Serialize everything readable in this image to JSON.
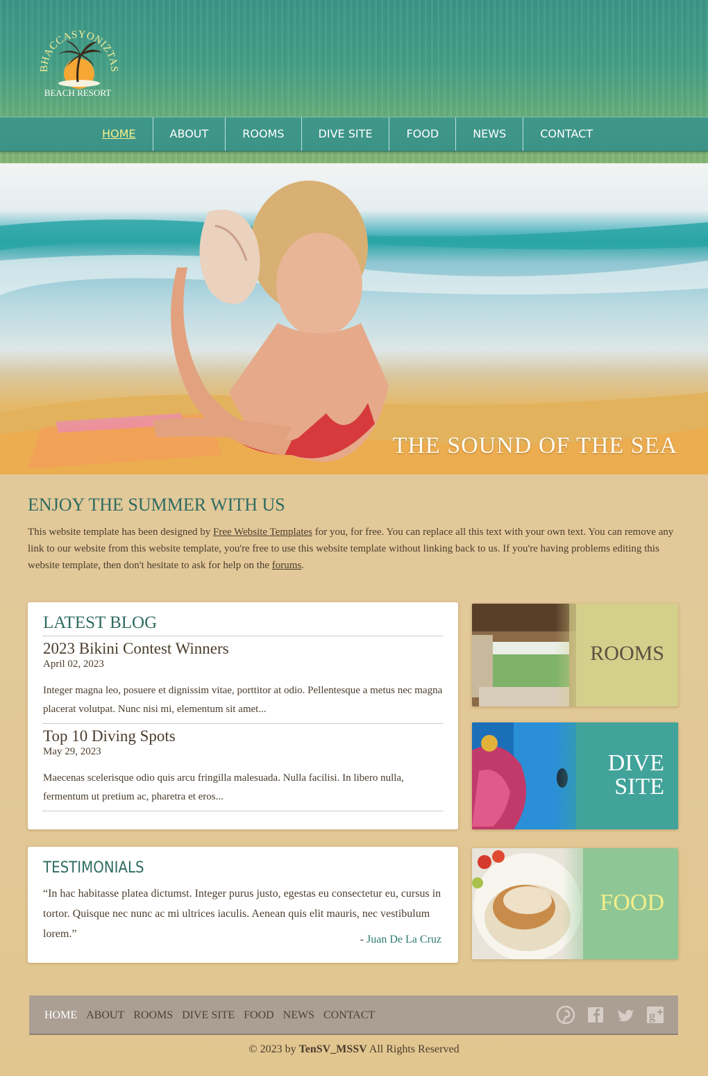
{
  "brand": {
    "arc_text": "BHACCASYONIZTAS",
    "subtitle": "BEACH RESORT"
  },
  "nav": {
    "items": [
      "HOME",
      "ABOUT",
      "ROOMS",
      "DIVE SITE",
      "FOOD",
      "NEWS",
      "CONTACT"
    ],
    "active": "HOME"
  },
  "hero": {
    "caption": "THE SOUND OF THE SEA"
  },
  "intro": {
    "heading": "ENJOY THE SUMMER WITH US",
    "text_1": "This website template has been designed by ",
    "link_1": "Free Website Templates",
    "text_2": " for you, for free. You can replace all this text with your own text. You can remove any link to our website from this website template, you're free to use this website template without linking back to us. If you're having problems editing this website template, then don't hesitate to ask for help on the ",
    "link_2": "forums",
    "text_3": "."
  },
  "blog": {
    "heading": "LATEST BLOG",
    "posts": [
      {
        "title": "2023 Bikini Contest Winners",
        "date": "April 02, 2023",
        "excerpt": "Integer magna leo, posuere et dignissim vitae, porttitor at odio. Pellentesque a metus nec magna placerat volutpat. Nunc nisi mi, elementum sit amet..."
      },
      {
        "title": "Top 10 Diving Spots",
        "date": "May 29, 2023",
        "excerpt": "Maecenas scelerisque odio quis arcu fringilla malesuada. Nulla facilisi. In libero nulla, fermentum ut pretium ac, pharetra et eros..."
      }
    ]
  },
  "testimonials": {
    "heading": "TESTIMONIALS",
    "quote": "“In hac habitasse platea dictumst. Integer purus justo, egestas eu consectetur eu, cursus in tortor. Quisque nec nunc ac mi ultrices iaculis. Aenean quis elit mauris, nec vestibulum lorem.”",
    "author_prefix": "- ",
    "author": "Juan De La Cruz"
  },
  "tiles": {
    "rooms": "ROOMS",
    "dive_line1": "DIVE",
    "dive_line2": "SITE",
    "food": "FOOD"
  },
  "footer": {
    "items": [
      "HOME",
      "ABOUT",
      "ROOMS",
      "DIVE SITE",
      "FOOD",
      "NEWS",
      "CONTACT"
    ],
    "active": "HOME",
    "social_icons": [
      "pinterest-icon",
      "facebook-icon",
      "twitter-icon",
      "google-plus-icon"
    ],
    "copyright_prefix": "© 2023 by ",
    "copyright_owner": "TenSV_MSSV",
    "copyright_suffix": " All Rights Reserved"
  },
  "colors": {
    "accent": "#2e6b60",
    "nav_bg": "#3f978a",
    "active_nav": "#f5f08a",
    "footer_bg": "#ab9f94"
  }
}
